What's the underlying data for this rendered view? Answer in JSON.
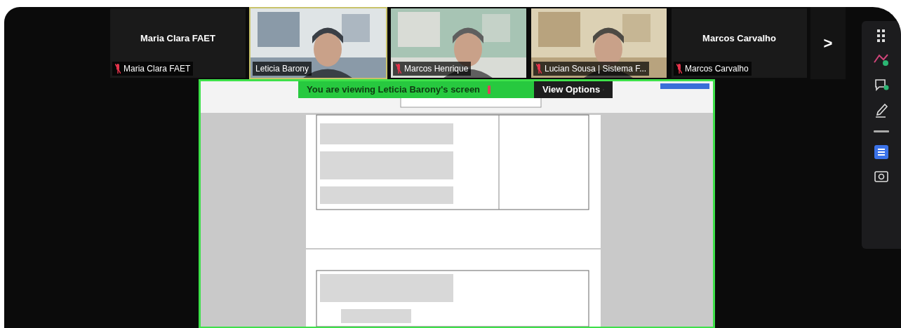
{
  "gallery": [
    {
      "kind": "avatar",
      "name": "Maria Clara FAET",
      "label": "Maria Clara FAET",
      "muted": true
    },
    {
      "kind": "video",
      "label": "Leticia Barony",
      "muted": false,
      "speaking": true
    },
    {
      "kind": "video",
      "label": "Marcos Henrique",
      "muted": true,
      "speaking": false
    },
    {
      "kind": "video",
      "label": "Lucian Sousa | Sistema F...",
      "muted": true,
      "speaking": false
    },
    {
      "kind": "avatar",
      "name": "Marcos Carvalho",
      "label": "Marcos Carvalho",
      "muted": true
    }
  ],
  "next_page": ">",
  "share_banner": {
    "text": "You are viewing Leticia Barony's screen"
  },
  "view_options": {
    "label": "View Options"
  }
}
